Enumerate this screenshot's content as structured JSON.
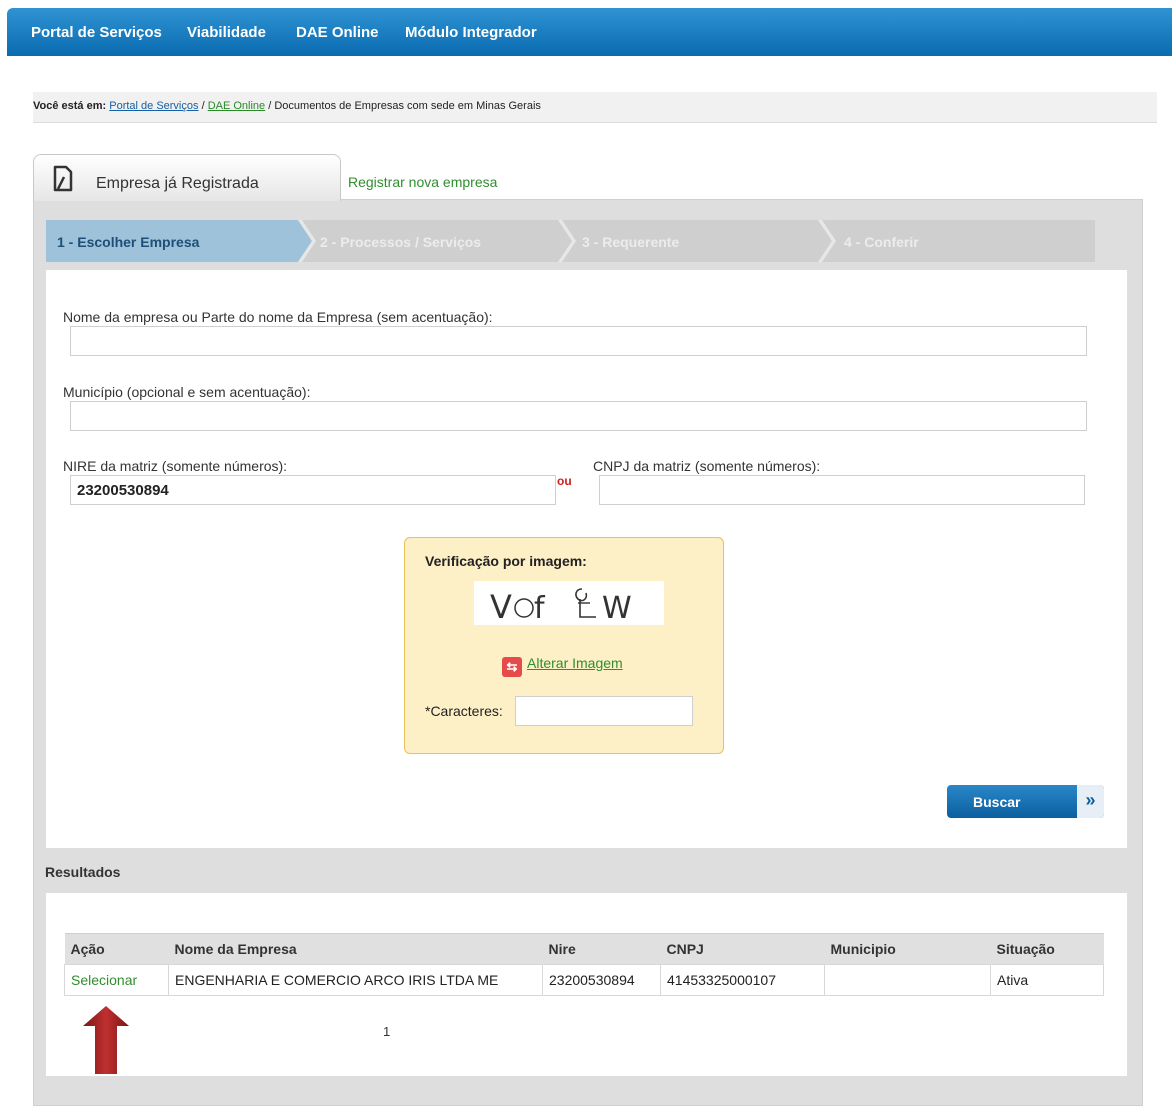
{
  "nav": [
    "Portal de Serviços",
    "Viabilidade",
    "DAE Online",
    "Módulo Integrador"
  ],
  "breadcrumb": {
    "prefix": "Você está em:",
    "link1": "Portal de Serviços",
    "sep1": "/",
    "link2": "DAE Online",
    "current": "/ Documentos de Empresas com sede em Minas Gerais"
  },
  "tabs": {
    "active": "Empresa já Registrada",
    "other": "Registrar nova empresa"
  },
  "steps": [
    "1 - Escolher Empresa",
    "2 - Processos / Serviços",
    "3 - Requerente",
    "4 - Conferir"
  ],
  "form": {
    "nome_label": "Nome da empresa ou Parte do nome da Empresa (sem acentuação):",
    "nome_value": "",
    "municipio_label": "Município (opcional e sem acentuação):",
    "municipio_value": "",
    "nire_label": "NIRE da matriz (somente números):",
    "nire_value": "23200530894",
    "ou": "ou",
    "cnpj_label": "CNPJ da matriz (somente números):",
    "cnpj_value": ""
  },
  "captcha": {
    "title": "Verificação por imagem:",
    "alterar": "Alterar Imagem",
    "caracteres_label": "*Caracteres:",
    "caracteres_value": ""
  },
  "buscar": "Buscar",
  "results": {
    "title": "Resultados",
    "columns": [
      "Ação",
      "Nome da Empresa",
      "Nire",
      "CNPJ",
      "Municipio",
      "Situação"
    ],
    "rows": [
      {
        "acao": "Selecionar",
        "nome": "ENGENHARIA E COMERCIO ARCO IRIS LTDA ME",
        "nire": "23200530894",
        "cnpj": "41453325000107",
        "municipio": "",
        "situacao": "Ativa"
      }
    ],
    "page": "1"
  },
  "colors": {
    "nav_blue": "#0a6bb0",
    "link_green": "#2f8f2f",
    "step_active": "#9dc2d9",
    "captcha_bg": "#fdefc6",
    "arrow_red": "#b02a2a"
  }
}
